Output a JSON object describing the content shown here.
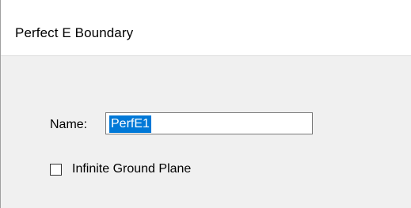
{
  "window": {
    "title": "Perfect E Boundary"
  },
  "form": {
    "name_label": "Name:",
    "name_value": "PerfE1",
    "checkbox": {
      "label": "Infinite Ground Plane",
      "checked": false
    }
  },
  "colors": {
    "selection_highlight": "#0078d7",
    "dialog_background": "#f0f0f0"
  }
}
